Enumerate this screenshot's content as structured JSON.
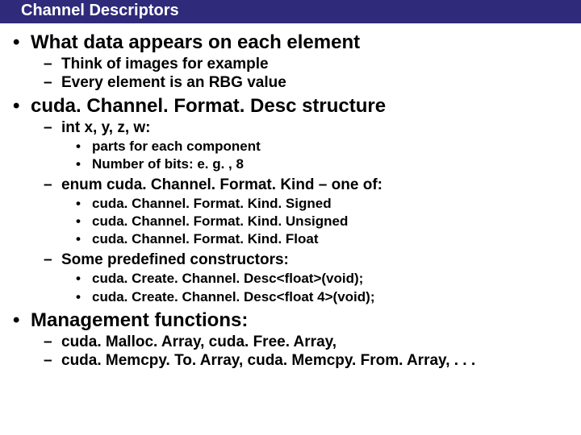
{
  "title": "Channel Descriptors",
  "l1_0": "What data appears on each element",
  "l2_0": "Think of images for example",
  "l2_1": "Every element is an RBG value",
  "l1_1": "cuda. Channel. Format. Desc structure",
  "l2_2": "int x, y, z, w:",
  "l3_0": "parts for each component",
  "l3_1": "Number of bits: e. g. , 8",
  "l2_3": "enum cuda. Channel. Format. Kind – one of:",
  "l3_2": "cuda. Channel. Format. Kind. Signed",
  "l3_3": "cuda. Channel. Format. Kind. Unsigned",
  "l3_4": "cuda. Channel. Format. Kind. Float",
  "l2_4": "Some predefined constructors:",
  "l3_5": "cuda. Create. Channel. Desc<float>(void);",
  "l3_6": "cuda. Create. Channel. Desc<float 4>(void);",
  "l1_2": "Management functions:",
  "l2_5": "cuda. Malloc. Array, cuda. Free. Array,",
  "l2_6": "cuda. Memcpy. To. Array, cuda. Memcpy. From. Array, . . ."
}
